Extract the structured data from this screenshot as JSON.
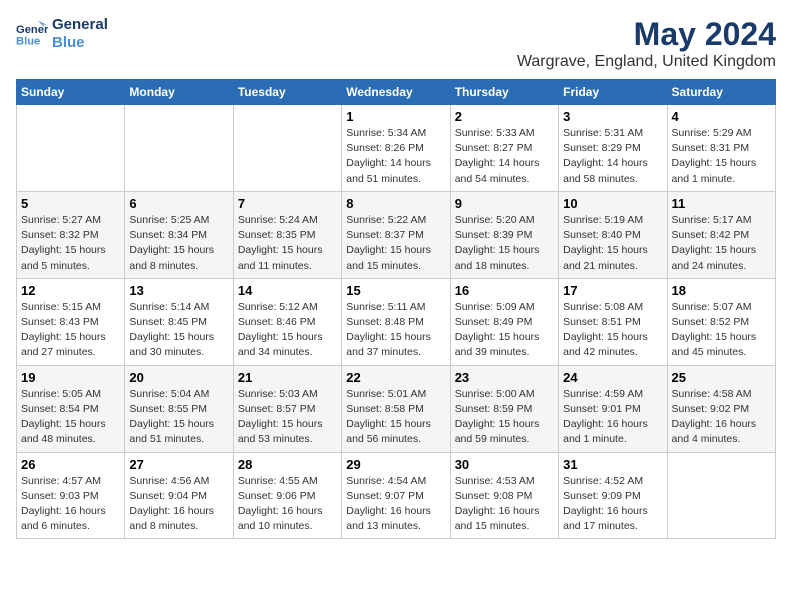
{
  "logo": {
    "line1": "General",
    "line2": "Blue"
  },
  "title": "May 2024",
  "subtitle": "Wargrave, England, United Kingdom",
  "weekdays": [
    "Sunday",
    "Monday",
    "Tuesday",
    "Wednesday",
    "Thursday",
    "Friday",
    "Saturday"
  ],
  "weeks": [
    [
      {
        "day": "",
        "sunrise": "",
        "sunset": "",
        "daylight": ""
      },
      {
        "day": "",
        "sunrise": "",
        "sunset": "",
        "daylight": ""
      },
      {
        "day": "",
        "sunrise": "",
        "sunset": "",
        "daylight": ""
      },
      {
        "day": "1",
        "sunrise": "Sunrise: 5:34 AM",
        "sunset": "Sunset: 8:26 PM",
        "daylight": "Daylight: 14 hours and 51 minutes."
      },
      {
        "day": "2",
        "sunrise": "Sunrise: 5:33 AM",
        "sunset": "Sunset: 8:27 PM",
        "daylight": "Daylight: 14 hours and 54 minutes."
      },
      {
        "day": "3",
        "sunrise": "Sunrise: 5:31 AM",
        "sunset": "Sunset: 8:29 PM",
        "daylight": "Daylight: 14 hours and 58 minutes."
      },
      {
        "day": "4",
        "sunrise": "Sunrise: 5:29 AM",
        "sunset": "Sunset: 8:31 PM",
        "daylight": "Daylight: 15 hours and 1 minute."
      }
    ],
    [
      {
        "day": "5",
        "sunrise": "Sunrise: 5:27 AM",
        "sunset": "Sunset: 8:32 PM",
        "daylight": "Daylight: 15 hours and 5 minutes."
      },
      {
        "day": "6",
        "sunrise": "Sunrise: 5:25 AM",
        "sunset": "Sunset: 8:34 PM",
        "daylight": "Daylight: 15 hours and 8 minutes."
      },
      {
        "day": "7",
        "sunrise": "Sunrise: 5:24 AM",
        "sunset": "Sunset: 8:35 PM",
        "daylight": "Daylight: 15 hours and 11 minutes."
      },
      {
        "day": "8",
        "sunrise": "Sunrise: 5:22 AM",
        "sunset": "Sunset: 8:37 PM",
        "daylight": "Daylight: 15 hours and 15 minutes."
      },
      {
        "day": "9",
        "sunrise": "Sunrise: 5:20 AM",
        "sunset": "Sunset: 8:39 PM",
        "daylight": "Daylight: 15 hours and 18 minutes."
      },
      {
        "day": "10",
        "sunrise": "Sunrise: 5:19 AM",
        "sunset": "Sunset: 8:40 PM",
        "daylight": "Daylight: 15 hours and 21 minutes."
      },
      {
        "day": "11",
        "sunrise": "Sunrise: 5:17 AM",
        "sunset": "Sunset: 8:42 PM",
        "daylight": "Daylight: 15 hours and 24 minutes."
      }
    ],
    [
      {
        "day": "12",
        "sunrise": "Sunrise: 5:15 AM",
        "sunset": "Sunset: 8:43 PM",
        "daylight": "Daylight: 15 hours and 27 minutes."
      },
      {
        "day": "13",
        "sunrise": "Sunrise: 5:14 AM",
        "sunset": "Sunset: 8:45 PM",
        "daylight": "Daylight: 15 hours and 30 minutes."
      },
      {
        "day": "14",
        "sunrise": "Sunrise: 5:12 AM",
        "sunset": "Sunset: 8:46 PM",
        "daylight": "Daylight: 15 hours and 34 minutes."
      },
      {
        "day": "15",
        "sunrise": "Sunrise: 5:11 AM",
        "sunset": "Sunset: 8:48 PM",
        "daylight": "Daylight: 15 hours and 37 minutes."
      },
      {
        "day": "16",
        "sunrise": "Sunrise: 5:09 AM",
        "sunset": "Sunset: 8:49 PM",
        "daylight": "Daylight: 15 hours and 39 minutes."
      },
      {
        "day": "17",
        "sunrise": "Sunrise: 5:08 AM",
        "sunset": "Sunset: 8:51 PM",
        "daylight": "Daylight: 15 hours and 42 minutes."
      },
      {
        "day": "18",
        "sunrise": "Sunrise: 5:07 AM",
        "sunset": "Sunset: 8:52 PM",
        "daylight": "Daylight: 15 hours and 45 minutes."
      }
    ],
    [
      {
        "day": "19",
        "sunrise": "Sunrise: 5:05 AM",
        "sunset": "Sunset: 8:54 PM",
        "daylight": "Daylight: 15 hours and 48 minutes."
      },
      {
        "day": "20",
        "sunrise": "Sunrise: 5:04 AM",
        "sunset": "Sunset: 8:55 PM",
        "daylight": "Daylight: 15 hours and 51 minutes."
      },
      {
        "day": "21",
        "sunrise": "Sunrise: 5:03 AM",
        "sunset": "Sunset: 8:57 PM",
        "daylight": "Daylight: 15 hours and 53 minutes."
      },
      {
        "day": "22",
        "sunrise": "Sunrise: 5:01 AM",
        "sunset": "Sunset: 8:58 PM",
        "daylight": "Daylight: 15 hours and 56 minutes."
      },
      {
        "day": "23",
        "sunrise": "Sunrise: 5:00 AM",
        "sunset": "Sunset: 8:59 PM",
        "daylight": "Daylight: 15 hours and 59 minutes."
      },
      {
        "day": "24",
        "sunrise": "Sunrise: 4:59 AM",
        "sunset": "Sunset: 9:01 PM",
        "daylight": "Daylight: 16 hours and 1 minute."
      },
      {
        "day": "25",
        "sunrise": "Sunrise: 4:58 AM",
        "sunset": "Sunset: 9:02 PM",
        "daylight": "Daylight: 16 hours and 4 minutes."
      }
    ],
    [
      {
        "day": "26",
        "sunrise": "Sunrise: 4:57 AM",
        "sunset": "Sunset: 9:03 PM",
        "daylight": "Daylight: 16 hours and 6 minutes."
      },
      {
        "day": "27",
        "sunrise": "Sunrise: 4:56 AM",
        "sunset": "Sunset: 9:04 PM",
        "daylight": "Daylight: 16 hours and 8 minutes."
      },
      {
        "day": "28",
        "sunrise": "Sunrise: 4:55 AM",
        "sunset": "Sunset: 9:06 PM",
        "daylight": "Daylight: 16 hours and 10 minutes."
      },
      {
        "day": "29",
        "sunrise": "Sunrise: 4:54 AM",
        "sunset": "Sunset: 9:07 PM",
        "daylight": "Daylight: 16 hours and 13 minutes."
      },
      {
        "day": "30",
        "sunrise": "Sunrise: 4:53 AM",
        "sunset": "Sunset: 9:08 PM",
        "daylight": "Daylight: 16 hours and 15 minutes."
      },
      {
        "day": "31",
        "sunrise": "Sunrise: 4:52 AM",
        "sunset": "Sunset: 9:09 PM",
        "daylight": "Daylight: 16 hours and 17 minutes."
      },
      {
        "day": "",
        "sunrise": "",
        "sunset": "",
        "daylight": ""
      }
    ]
  ]
}
